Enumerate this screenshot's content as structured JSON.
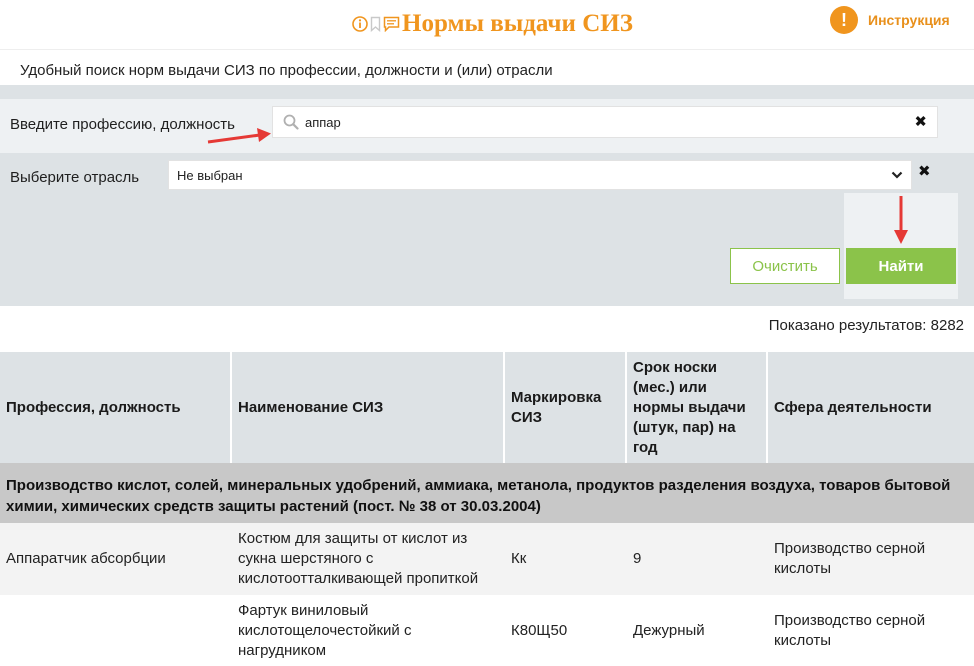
{
  "header": {
    "title": "Нормы выдачи СИЗ",
    "title_icons": [
      "info-icon",
      "bookmark-icon",
      "comment-icon"
    ],
    "instruction_label": "Инструкция",
    "instruction_icon_glyph": "!"
  },
  "subtitle": "Удобный поиск норм выдачи СИЗ по профессии, должности и (или) отрасли",
  "search": {
    "profession_label": "Введите профессию, должность",
    "profession_value": "аппар",
    "industry_label": "Выберите отрасль",
    "industry_value": "Не выбран",
    "clear_glyph": "✖",
    "clear_button": "Очистить",
    "find_button": "Найти"
  },
  "results_count": "Показано результатов: 8282",
  "table": {
    "columns": [
      "Профессия, должность",
      "Наименование СИЗ",
      "Маркировка СИЗ",
      "Срок носки (мес.) или нормы выдачи (штук, пар) на год",
      "Сфера деятельности"
    ],
    "group_title": "Производство кислот, солей, минеральных удобрений, аммиака, метанола, продуктов разделения воздуха, товаров бытовой химии, химических средств защиты растений (пост. № 38 от 30.03.2004)",
    "rows": [
      [
        "Аппаратчик абсорбции",
        "Костюм для защиты от кислот из сукна шерстяного с кислотоотталкивающей пропиткой",
        "Кк",
        "9",
        "Производство серной кислоты"
      ],
      [
        "",
        "Фартук виниловый кислотощелочестойкий с нагрудником",
        "К80Щ50",
        "Дежурный",
        "Производство серной кислоты"
      ]
    ]
  },
  "colors": {
    "accent_orange": "#f0951e",
    "button_green": "#8bc34a",
    "annotation_red": "#e53935"
  }
}
